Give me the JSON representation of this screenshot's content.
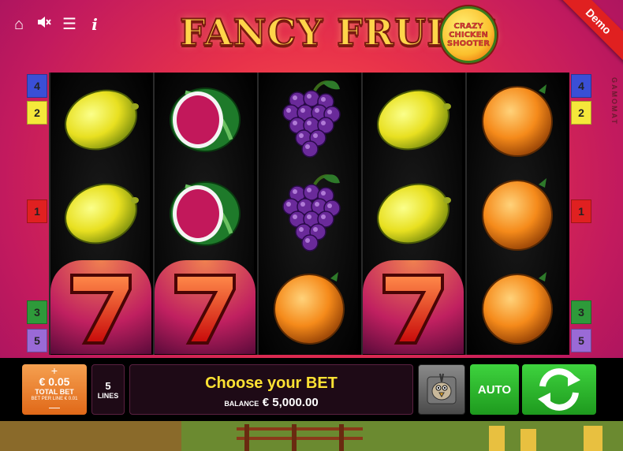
{
  "header": {
    "title": "FANCY FRUITS",
    "badge_line1": "CRAZY",
    "badge_line2": "CHICKEN",
    "badge_line3": "SHOOTER",
    "demo_label": "Demo",
    "provider": "GAMOMAT",
    "icons": [
      "home-icon",
      "sound-muted-icon",
      "menu-icon",
      "info-icon"
    ]
  },
  "lines_left": [
    {
      "label": "4",
      "color": "#3a4fd6"
    },
    {
      "label": "2",
      "color": "#f5e83a"
    },
    {
      "label": "1",
      "color": "#e02020"
    },
    {
      "label": "3",
      "color": "#2e9a3a"
    },
    {
      "label": "5",
      "color": "#9a6ad6"
    }
  ],
  "lines_right": [
    {
      "label": "4",
      "color": "#3a4fd6"
    },
    {
      "label": "2",
      "color": "#f5e83a"
    },
    {
      "label": "1",
      "color": "#e02020"
    },
    {
      "label": "3",
      "color": "#2e9a3a"
    },
    {
      "label": "5",
      "color": "#9a6ad6"
    }
  ],
  "reels": [
    [
      "lemon",
      "lemon",
      "seven"
    ],
    [
      "watermelon",
      "watermelon",
      "seven"
    ],
    [
      "grapes",
      "grapes",
      "orange"
    ],
    [
      "lemon",
      "lemon",
      "seven"
    ],
    [
      "orange",
      "orange",
      "orange"
    ]
  ],
  "controls": {
    "bet_plus": "+",
    "bet_value": "€ 0.05",
    "bet_label": "TOTAL BET",
    "bet_per_line": "BET PER LINE € 0.01",
    "bet_minus": "—",
    "lines_value": "5",
    "lines_label": "LINES",
    "message": "Choose your BET",
    "balance_label": "BALANCE",
    "balance_value": "€ 5,000.00",
    "auto_label": "AUTO",
    "spin_icon": "spin-arrows-icon",
    "gamble_icon": "chicken-icon"
  }
}
